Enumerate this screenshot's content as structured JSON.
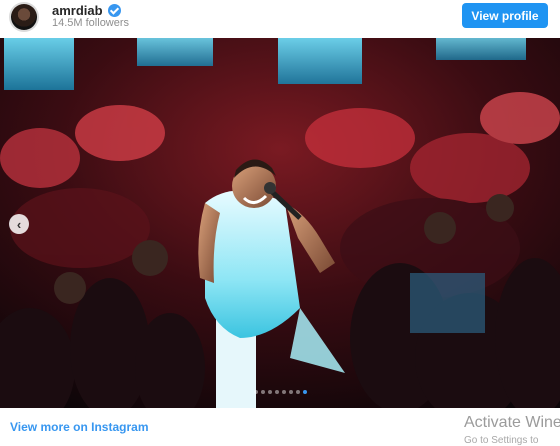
{
  "header": {
    "username": "amrdiab",
    "verified_icon": "verified-badge-icon",
    "followers": "14.5M followers",
    "view_profile_label": "View profile"
  },
  "media": {
    "description": "Concert photo: performer in white sleeveless outfit singing into microphone in front of crowd",
    "carousel_dots": 8,
    "active_dot": 8,
    "prev_icon": "chevron-left-icon",
    "prev_glyph": "‹"
  },
  "footer": {
    "view_more_label": "View more on Instagram"
  },
  "watermark": {
    "title": "Activate Wine",
    "subtitle": "Go to Settings to"
  },
  "colors": {
    "accent": "#1f94f2",
    "link": "#3897f0"
  }
}
